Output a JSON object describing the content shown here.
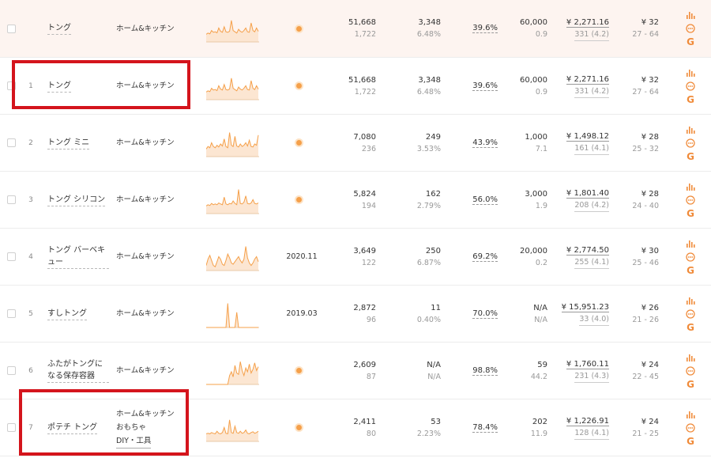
{
  "colors": {
    "accent": "#f5a04a",
    "highlight": "#d4141c",
    "summary_bg": "#fdf4f0"
  },
  "rows": [
    {
      "idx": "",
      "keyword": "トング",
      "categories": [
        "ホーム&キッチン"
      ],
      "trend": "dot",
      "date": "",
      "search_volume": "51,668",
      "search_volume_sub": "1,722",
      "sales": "3,348",
      "sales_sub": "6.48%",
      "click_share": "39.6%",
      "kw_sales": "60,000",
      "kw_sales_sub": "0.9",
      "price": "¥ 2,271.16",
      "price_sub": "331 (4.2)",
      "avg": "¥ 32",
      "avg_sub": "27 - 64",
      "spark": [
        0.3,
        0.35,
        0.32,
        0.45,
        0.38,
        0.4,
        0.36,
        0.55,
        0.42,
        0.38,
        0.6,
        0.4,
        0.38,
        0.42,
        0.85,
        0.45,
        0.4,
        0.35,
        0.5,
        0.42,
        0.38,
        0.45,
        0.55,
        0.4,
        0.38,
        0.75,
        0.45,
        0.4,
        0.55,
        0.42
      ]
    },
    {
      "idx": "1",
      "keyword": "トング",
      "categories": [
        "ホーム&キッチン"
      ],
      "trend": "dot",
      "date": "",
      "search_volume": "51,668",
      "search_volume_sub": "1,722",
      "sales": "3,348",
      "sales_sub": "6.48%",
      "click_share": "39.6%",
      "kw_sales": "60,000",
      "kw_sales_sub": "0.9",
      "price": "¥ 2,271.16",
      "price_sub": "331 (4.2)",
      "avg": "¥ 32",
      "avg_sub": "27 - 64",
      "spark": [
        0.3,
        0.35,
        0.32,
        0.45,
        0.38,
        0.4,
        0.36,
        0.55,
        0.42,
        0.38,
        0.6,
        0.4,
        0.38,
        0.42,
        0.85,
        0.45,
        0.4,
        0.35,
        0.5,
        0.42,
        0.38,
        0.45,
        0.55,
        0.4,
        0.38,
        0.75,
        0.45,
        0.4,
        0.55,
        0.42
      ]
    },
    {
      "idx": "2",
      "keyword": "トング ミニ",
      "categories": [
        "ホーム&キッチン"
      ],
      "trend": "dot",
      "date": "",
      "search_volume": "7,080",
      "search_volume_sub": "236",
      "sales": "249",
      "sales_sub": "3.53%",
      "click_share": "43.9%",
      "kw_sales": "1,000",
      "kw_sales_sub": "7.1",
      "price": "¥ 1,498.12",
      "price_sub": "161 (4.1)",
      "avg": "¥ 28",
      "avg_sub": "25 - 32",
      "spark": [
        0.3,
        0.4,
        0.35,
        0.55,
        0.4,
        0.35,
        0.45,
        0.38,
        0.5,
        0.42,
        0.7,
        0.4,
        0.35,
        0.95,
        0.45,
        0.4,
        0.8,
        0.42,
        0.38,
        0.5,
        0.4,
        0.45,
        0.55,
        0.42,
        0.65,
        0.4,
        0.38,
        0.5,
        0.45,
        0.85
      ]
    },
    {
      "idx": "3",
      "keyword": "トング シリコン",
      "categories": [
        "ホーム&キッチン"
      ],
      "trend": "dot",
      "date": "",
      "search_volume": "5,824",
      "search_volume_sub": "194",
      "sales": "162",
      "sales_sub": "2.79%",
      "click_share": "56.0%",
      "kw_sales": "3,000",
      "kw_sales_sub": "1.9",
      "price": "¥ 1,801.40",
      "price_sub": "208 (4.2)",
      "avg": "¥ 28",
      "avg_sub": "24 - 40",
      "spark": [
        0.3,
        0.35,
        0.32,
        0.4,
        0.35,
        0.38,
        0.35,
        0.42,
        0.38,
        0.35,
        0.65,
        0.38,
        0.35,
        0.4,
        0.38,
        0.5,
        0.4,
        0.35,
        0.95,
        0.4,
        0.38,
        0.45,
        0.7,
        0.4,
        0.38,
        0.42,
        0.55,
        0.4,
        0.38,
        0.42
      ]
    },
    {
      "idx": "4",
      "keyword": "トング バーベキュー",
      "categories": [
        "ホーム&キッチン"
      ],
      "trend": "date",
      "date": "2020.11",
      "search_volume": "3,649",
      "search_volume_sub": "122",
      "sales": "250",
      "sales_sub": "6.87%",
      "click_share": "69.2%",
      "kw_sales": "20,000",
      "kw_sales_sub": "0.2",
      "price": "¥ 2,774.50",
      "price_sub": "255 (4.1)",
      "avg": "¥ 30",
      "avg_sub": "25 - 46",
      "spark": [
        0.2,
        0.45,
        0.6,
        0.4,
        0.2,
        0.15,
        0.35,
        0.55,
        0.45,
        0.25,
        0.2,
        0.4,
        0.65,
        0.5,
        0.3,
        0.25,
        0.35,
        0.45,
        0.55,
        0.4,
        0.3,
        0.45,
        0.95,
        0.5,
        0.3,
        0.2,
        0.3,
        0.45,
        0.55,
        0.35
      ]
    },
    {
      "idx": "5",
      "keyword": "すしトング",
      "categories": [
        "ホーム&キッチン"
      ],
      "trend": "date",
      "date": "2019.03",
      "search_volume": "2,872",
      "search_volume_sub": "96",
      "sales": "11",
      "sales_sub": "0.40%",
      "click_share": "70.0%",
      "kw_sales": "N/A",
      "kw_sales_sub": "N/A",
      "price": "¥ 15,951.23",
      "price_sub": "33 (4.0)",
      "avg": "¥ 26",
      "avg_sub": "21 - 26",
      "spark": [
        0.0,
        0.0,
        0.0,
        0.0,
        0.0,
        0.0,
        0.0,
        0.0,
        0.0,
        0.0,
        0.0,
        0.0,
        0.95,
        0.0,
        0.0,
        0.0,
        0.0,
        0.6,
        0.0,
        0.0,
        0.0,
        0.0,
        0.0,
        0.0,
        0.0,
        0.0,
        0.0,
        0.0,
        0.0,
        0.0
      ]
    },
    {
      "idx": "6",
      "keyword": "ふたがトングになる保存容器",
      "categories": [
        "ホーム&キッチン"
      ],
      "trend": "dot",
      "date": "",
      "search_volume": "2,609",
      "search_volume_sub": "87",
      "sales": "N/A",
      "sales_sub": "N/A",
      "click_share": "98.8%",
      "kw_sales": "59",
      "kw_sales_sub": "44.2",
      "price": "¥ 1,760.11",
      "price_sub": "231 (4.3)",
      "avg": "¥ 24",
      "avg_sub": "22 - 45",
      "spark": [
        0.0,
        0.0,
        0.0,
        0.0,
        0.0,
        0.0,
        0.0,
        0.0,
        0.0,
        0.0,
        0.0,
        0.0,
        0.0,
        0.35,
        0.5,
        0.3,
        0.75,
        0.45,
        0.4,
        0.9,
        0.55,
        0.35,
        0.65,
        0.5,
        0.8,
        0.45,
        0.6,
        0.85,
        0.55,
        0.7
      ]
    },
    {
      "idx": "7",
      "keyword": "ポテチ トング",
      "categories": [
        "ホーム&キッチン",
        "おもちゃ",
        "DIY・工具"
      ],
      "trend": "dot",
      "date": "",
      "search_volume": "2,411",
      "search_volume_sub": "80",
      "sales": "53",
      "sales_sub": "2.23%",
      "click_share": "78.4%",
      "kw_sales": "202",
      "kw_sales_sub": "11.9",
      "price": "¥ 1,226.91",
      "price_sub": "128 (4.1)",
      "avg": "¥ 24",
      "avg_sub": "21 - 25",
      "spark": [
        0.3,
        0.32,
        0.3,
        0.35,
        0.32,
        0.3,
        0.4,
        0.32,
        0.3,
        0.35,
        0.55,
        0.32,
        0.3,
        0.85,
        0.35,
        0.32,
        0.6,
        0.35,
        0.32,
        0.4,
        0.32,
        0.35,
        0.45,
        0.32,
        0.3,
        0.35,
        0.38,
        0.32,
        0.35,
        0.4
      ]
    }
  ],
  "icons": [
    "bar-chart-icon",
    "more-icon",
    "google-icon"
  ],
  "google_glyph": "G"
}
